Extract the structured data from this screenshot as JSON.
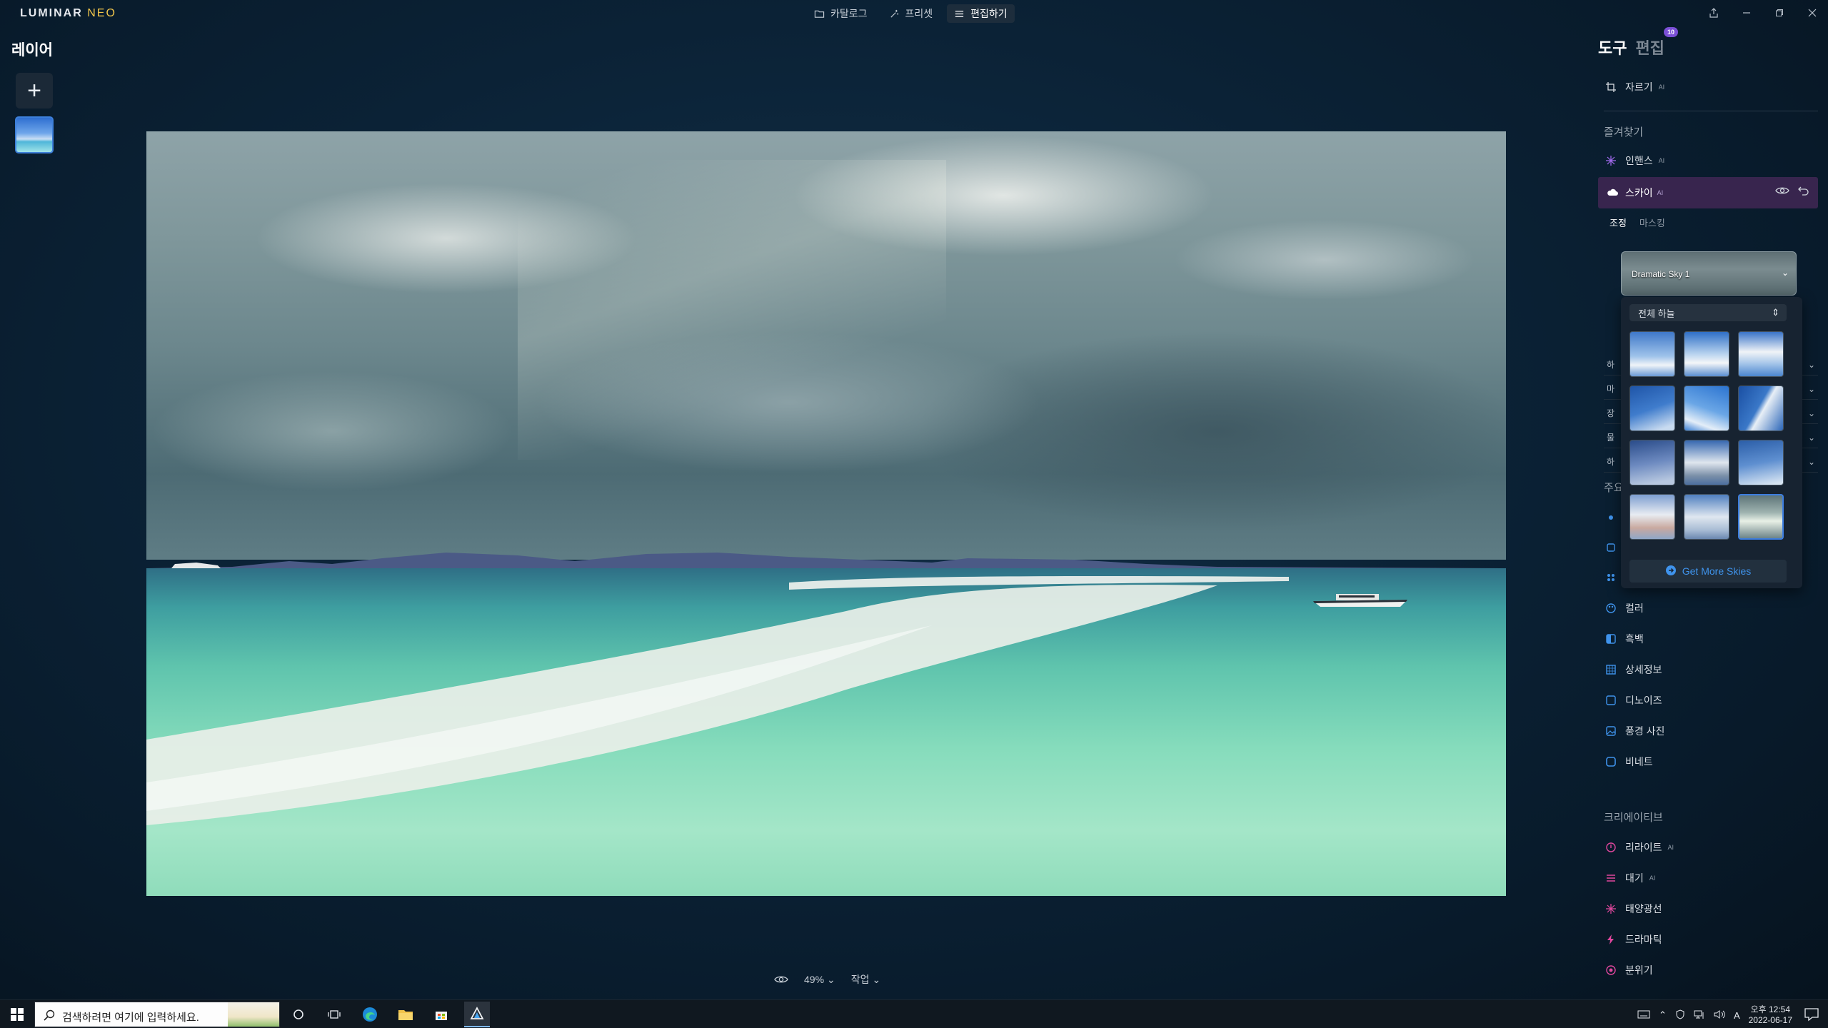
{
  "app": {
    "logo_main": "LUMINAR",
    "logo_accent": "NEO"
  },
  "modes": [
    {
      "label": "카탈로그",
      "icon": "folder-icon"
    },
    {
      "label": "프리셋",
      "icon": "magic-wand-icon"
    },
    {
      "label": "편집하기",
      "icon": "sliders-icon",
      "active": true
    }
  ],
  "layers": {
    "title": "레이어",
    "add_label": "+"
  },
  "bottom": {
    "zoom": "49%",
    "action": "작업"
  },
  "panel": {
    "tab_tools": "도구",
    "tab_edits": "편집",
    "edits_badge": "10",
    "crop": "자르기",
    "favorites_title": "즐겨찾기",
    "enhance": "인핸스",
    "sky": "스카이",
    "sub_adjust": "조정",
    "sub_masking": "마스킹",
    "sky_preset": "Dramatic Sky 1",
    "sky_filter": "전체 하늘",
    "get_more": "Get More Skies",
    "collapsed_rows": [
      "하",
      "마",
      "장",
      "물",
      "하"
    ],
    "essentials_title_partial": "주요",
    "tools": [
      "컬러",
      "흑백",
      "상세정보",
      "디노이즈",
      "풍경 사진",
      "비네트"
    ],
    "creative_title": "크리에이티브",
    "creative_tools": [
      "리라이트",
      "대기",
      "태양광선",
      "드라마틱",
      "분위기"
    ],
    "ai_marker": "AI"
  },
  "taskbar": {
    "search_placeholder": "검색하려면 여기에 입력하세요.",
    "time": "오후 12:54",
    "date": "2022-06-17",
    "ime": "A"
  },
  "colors": {
    "accent_purple": "#38254e",
    "accent_blue": "#3c7de0",
    "link_blue": "#3f93ec"
  }
}
